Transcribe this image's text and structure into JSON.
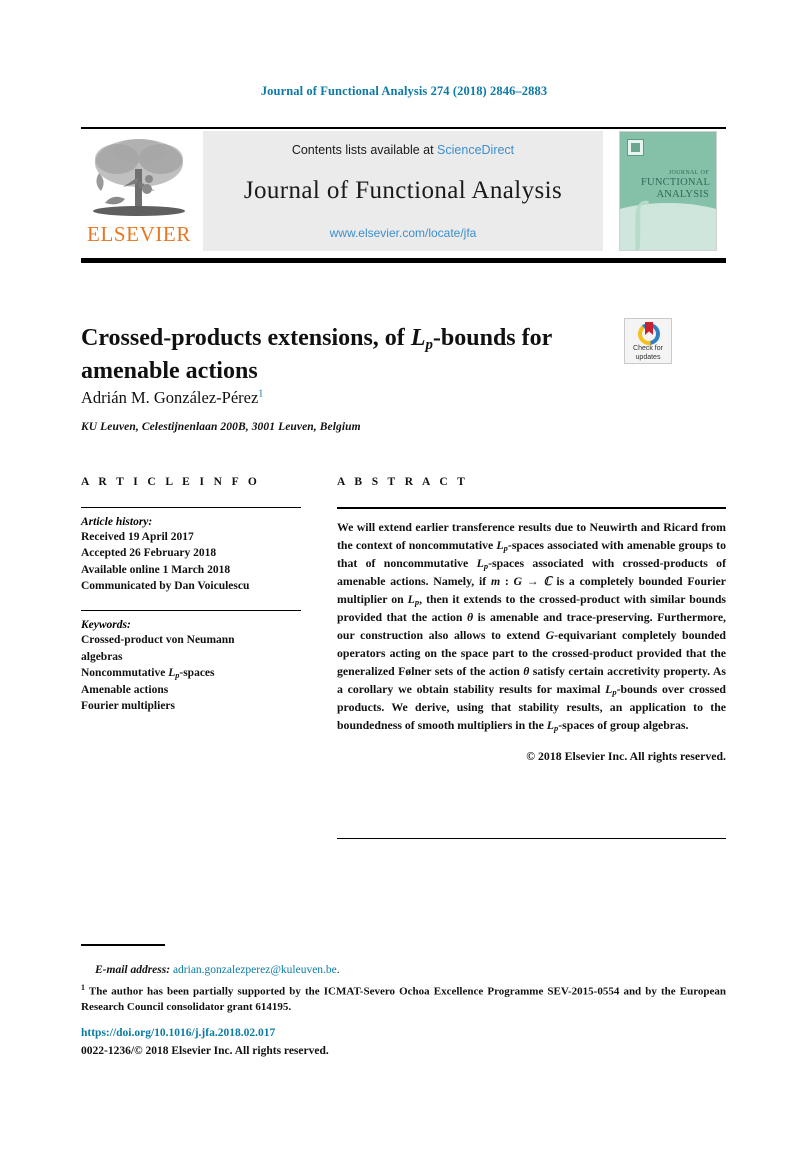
{
  "header": {
    "journal_reference": "Journal of Functional Analysis 274 (2018) 2846–2883"
  },
  "masthead": {
    "contents_prefix": "Contents lists available at ",
    "sciencedirect": "ScienceDirect",
    "journal_name": "Journal of Functional Analysis",
    "journal_url": "www.elsevier.com/locate/jfa",
    "publisher_logo_text": "ELSEVIER",
    "cover": {
      "line1": "JOURNAL OF",
      "line2": "FUNCTIONAL",
      "line3": "ANALYSIS"
    }
  },
  "article": {
    "title_line1_a": "Crossed-products extensions, of ",
    "title_L": "L",
    "title_p": "p",
    "title_line1_b": "-bounds for",
    "title_line2": "amenable actions",
    "author": "Adrián M. González-Pérez",
    "author_footnote_mark": "1",
    "affiliation": "KU Leuven, Celestijnenlaan 200B, 3001 Leuven, Belgium"
  },
  "crossmark": {
    "label_line1": "Check for",
    "label_line2": "updates"
  },
  "info": {
    "heading": "A R T I C L E   I N F O",
    "history_label": "Article history:",
    "history": [
      "Received 19 April 2017",
      "Accepted 26 February 2018",
      "Available online 1 March 2018",
      "Communicated by Dan Voiculescu"
    ],
    "keywords_label": "Keywords:",
    "keywords": [
      "Crossed-product von Neumann",
      "algebras",
      "Noncommutative Lp-spaces",
      "Amenable actions",
      "Fourier multipliers"
    ]
  },
  "abstract": {
    "heading": "A B S T R A C T",
    "p1": "We will extend earlier transference results due to Neuwirth and Ricard from the context of noncommutative Lp-spaces associated with amenable groups to that of noncommutative Lp-spaces associated with crossed-products of amenable actions. Namely, if m : G → C is a completely bounded Fourier multiplier on Lp, then it extends to the crossed-product with similar bounds provided that the action θ is amenable and trace-preserving. Furthermore, our construction also allows to extend G-equivariant completely bounded operators acting on the space part to the crossed-product provided that the generalized Følner sets of the action θ satisfy certain accretivity property. As a corollary we obtain stability results for maximal Lp-bounds over crossed products. We derive, using that stability results, an application to the boundedness of smooth multipliers in the Lp-spaces of group algebras.",
    "copyright": "© 2018 Elsevier Inc. All rights reserved."
  },
  "footnotes": {
    "email_label": "E-mail address:",
    "email_address": "adrian.gonzalezperez@kuleuven.be",
    "funding_mark": "1",
    "funding_text": "The author has been partially supported by the ICMAT-Severo Ochoa Excellence Programme SEV-2015-0554 and by the European Research Council consolidator grant 614195."
  },
  "footer": {
    "doi": "https://doi.org/10.1016/j.jfa.2018.02.017",
    "issn_copyright": "0022-1236/© 2018 Elsevier Inc. All rights reserved."
  },
  "colors": {
    "link_blue": "#0b7aa5",
    "sciencedirect_blue": "#3c8fce",
    "elsevier_orange": "#e87722",
    "cover_teal": "#84c1a8"
  }
}
